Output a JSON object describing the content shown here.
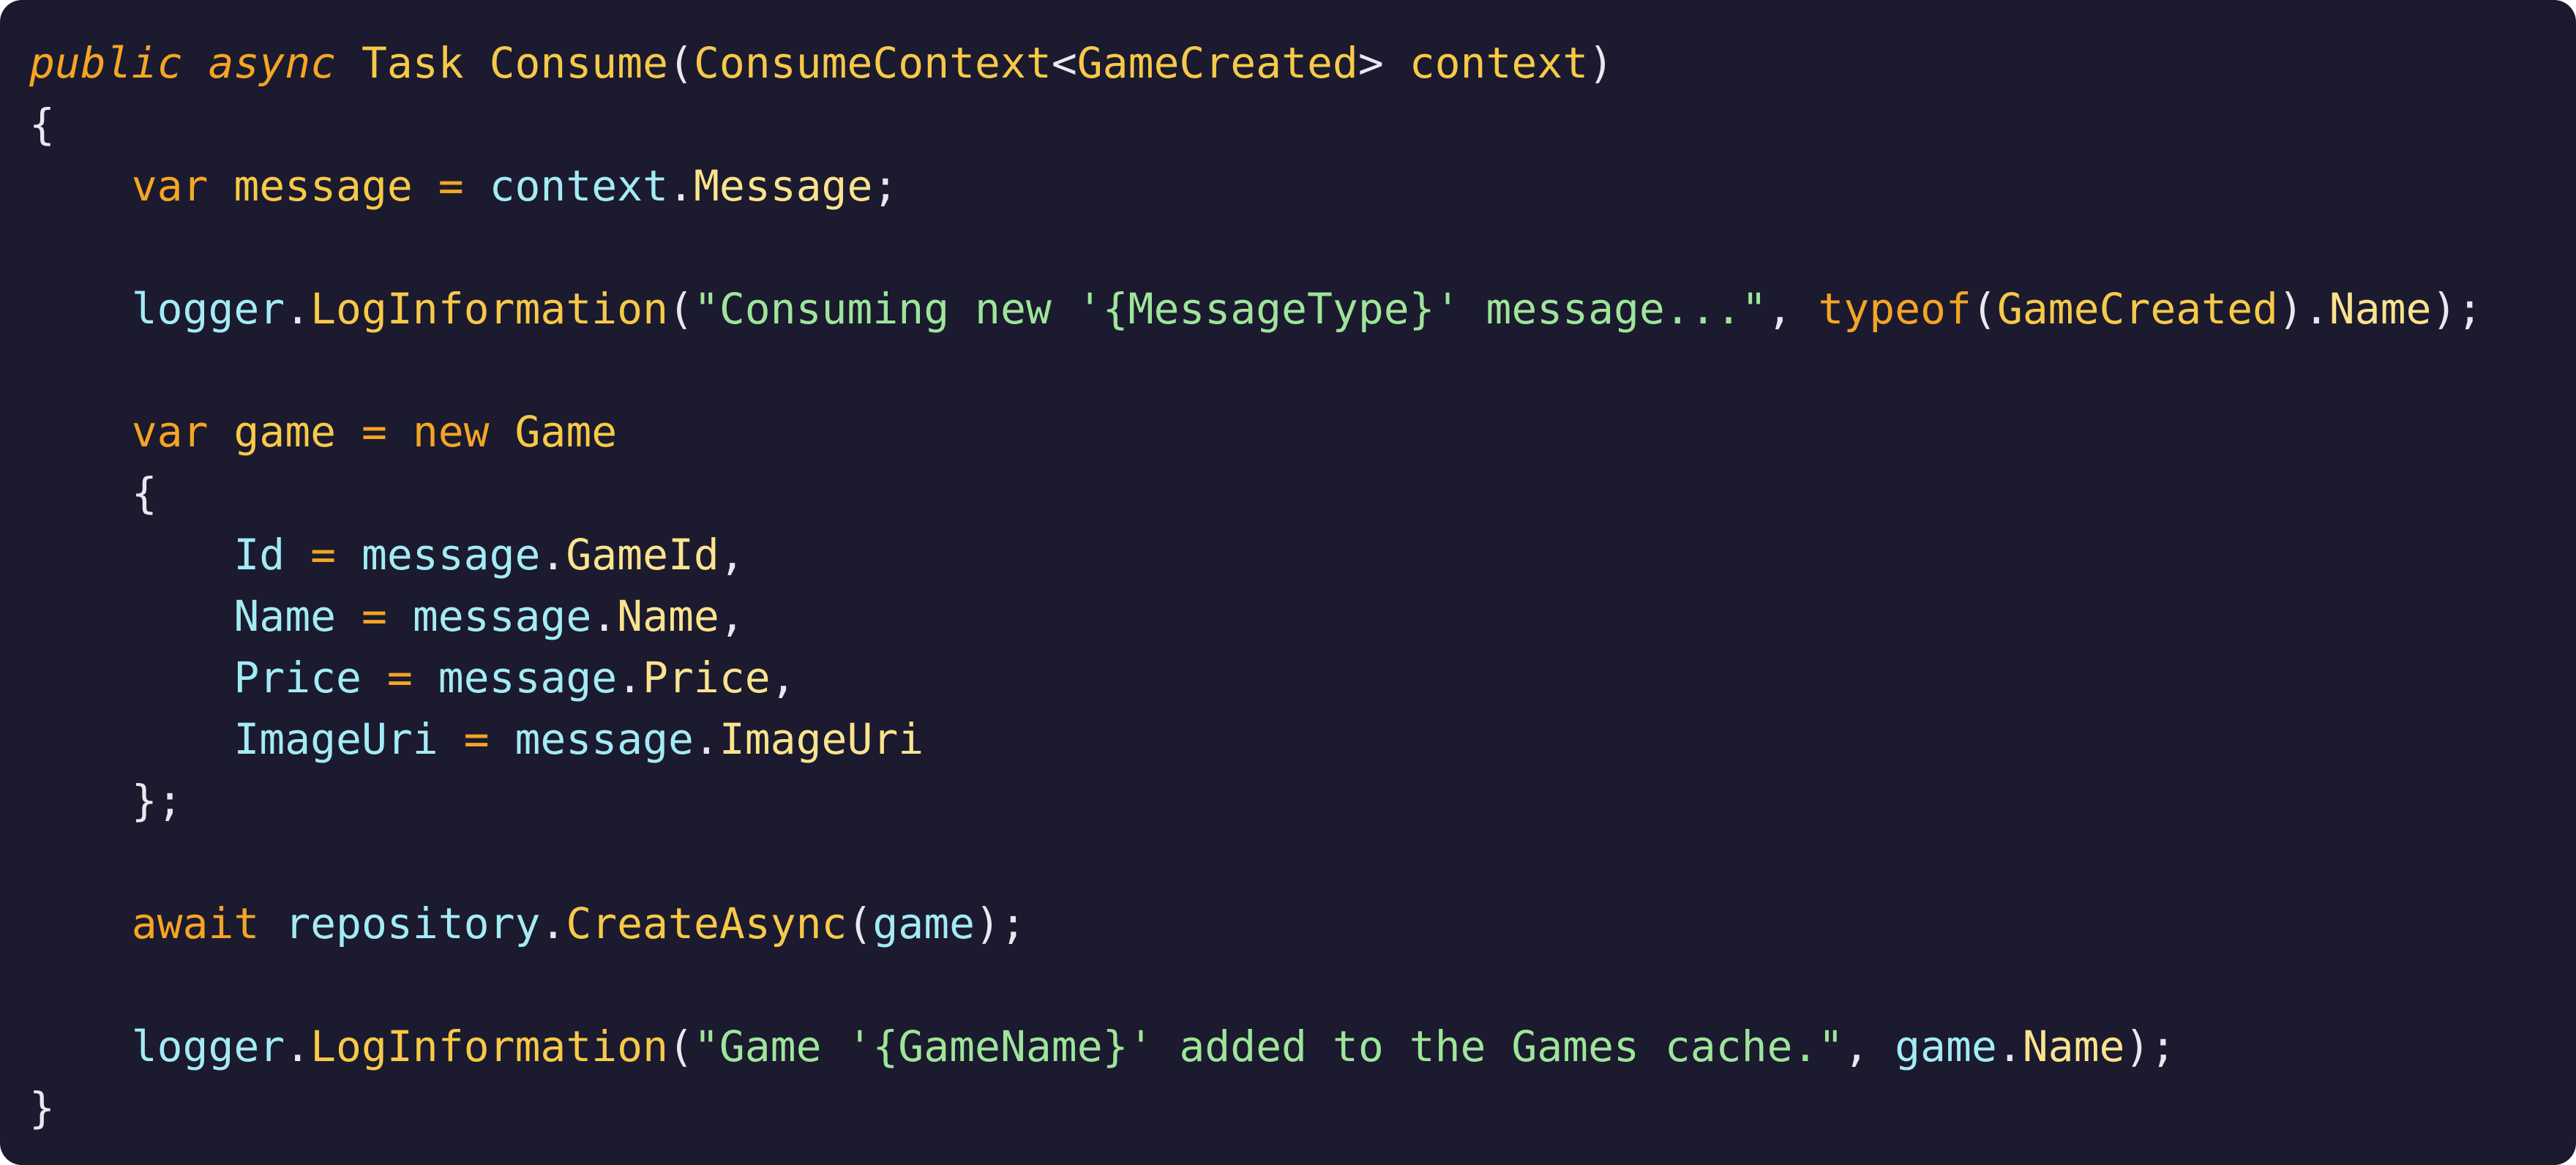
{
  "colors": {
    "background": "#1b1a2f",
    "keyword": "#f5a524",
    "type": "#f7c948",
    "method": "#f7c948",
    "member": "#fbe38e",
    "identifier": "#a3ebf5",
    "string": "#9ee59a",
    "punctuation": "#e8e8f0",
    "operator": "#f5a524"
  },
  "code": {
    "lines": [
      {
        "tokens": [
          {
            "t": "public",
            "c": "keyword",
            "i": true
          },
          {
            "t": " ",
            "c": "punctuation"
          },
          {
            "t": "async",
            "c": "keyword",
            "i": true
          },
          {
            "t": " ",
            "c": "punctuation"
          },
          {
            "t": "Task",
            "c": "type"
          },
          {
            "t": " ",
            "c": "punctuation"
          },
          {
            "t": "Consume",
            "c": "method"
          },
          {
            "t": "(",
            "c": "punctuation"
          },
          {
            "t": "ConsumeContext",
            "c": "type"
          },
          {
            "t": "<",
            "c": "punctuation"
          },
          {
            "t": "GameCreated",
            "c": "type"
          },
          {
            "t": "> ",
            "c": "punctuation"
          },
          {
            "t": "context",
            "c": "method"
          },
          {
            "t": ")",
            "c": "punctuation"
          }
        ]
      },
      {
        "tokens": [
          {
            "t": "{",
            "c": "punctuation"
          }
        ]
      },
      {
        "tokens": [
          {
            "t": "    ",
            "c": "punctuation"
          },
          {
            "t": "var",
            "c": "keyword"
          },
          {
            "t": " ",
            "c": "punctuation"
          },
          {
            "t": "message",
            "c": "type"
          },
          {
            "t": " ",
            "c": "punctuation"
          },
          {
            "t": "=",
            "c": "operator"
          },
          {
            "t": " ",
            "c": "punctuation"
          },
          {
            "t": "context",
            "c": "identifier"
          },
          {
            "t": ".",
            "c": "punctuation"
          },
          {
            "t": "Message",
            "c": "member"
          },
          {
            "t": ";",
            "c": "punctuation"
          }
        ]
      },
      {
        "tokens": []
      },
      {
        "tokens": [
          {
            "t": "    ",
            "c": "punctuation"
          },
          {
            "t": "logger",
            "c": "identifier"
          },
          {
            "t": ".",
            "c": "punctuation"
          },
          {
            "t": "LogInformation",
            "c": "method"
          },
          {
            "t": "(",
            "c": "punctuation"
          },
          {
            "t": "\"Consuming new '{MessageType}' message...\"",
            "c": "string"
          },
          {
            "t": ", ",
            "c": "punctuation"
          },
          {
            "t": "typeof",
            "c": "keyword"
          },
          {
            "t": "(",
            "c": "punctuation"
          },
          {
            "t": "GameCreated",
            "c": "type"
          },
          {
            "t": ").",
            "c": "punctuation"
          },
          {
            "t": "Name",
            "c": "member"
          },
          {
            "t": ");",
            "c": "punctuation"
          }
        ]
      },
      {
        "tokens": []
      },
      {
        "tokens": [
          {
            "t": "    ",
            "c": "punctuation"
          },
          {
            "t": "var",
            "c": "keyword"
          },
          {
            "t": " ",
            "c": "punctuation"
          },
          {
            "t": "game",
            "c": "type"
          },
          {
            "t": " ",
            "c": "punctuation"
          },
          {
            "t": "=",
            "c": "operator"
          },
          {
            "t": " ",
            "c": "punctuation"
          },
          {
            "t": "new",
            "c": "keyword"
          },
          {
            "t": " ",
            "c": "punctuation"
          },
          {
            "t": "Game",
            "c": "type"
          }
        ]
      },
      {
        "tokens": [
          {
            "t": "    ",
            "c": "punctuation"
          },
          {
            "t": "{",
            "c": "punctuation"
          }
        ]
      },
      {
        "tokens": [
          {
            "t": "        ",
            "c": "punctuation"
          },
          {
            "t": "Id",
            "c": "identifier"
          },
          {
            "t": " ",
            "c": "punctuation"
          },
          {
            "t": "=",
            "c": "operator"
          },
          {
            "t": " ",
            "c": "punctuation"
          },
          {
            "t": "message",
            "c": "identifier"
          },
          {
            "t": ".",
            "c": "punctuation"
          },
          {
            "t": "GameId",
            "c": "member"
          },
          {
            "t": ",",
            "c": "punctuation"
          }
        ]
      },
      {
        "tokens": [
          {
            "t": "        ",
            "c": "punctuation"
          },
          {
            "t": "Name",
            "c": "identifier"
          },
          {
            "t": " ",
            "c": "punctuation"
          },
          {
            "t": "=",
            "c": "operator"
          },
          {
            "t": " ",
            "c": "punctuation"
          },
          {
            "t": "message",
            "c": "identifier"
          },
          {
            "t": ".",
            "c": "punctuation"
          },
          {
            "t": "Name",
            "c": "member"
          },
          {
            "t": ",",
            "c": "punctuation"
          }
        ]
      },
      {
        "tokens": [
          {
            "t": "        ",
            "c": "punctuation"
          },
          {
            "t": "Price",
            "c": "identifier"
          },
          {
            "t": " ",
            "c": "punctuation"
          },
          {
            "t": "=",
            "c": "operator"
          },
          {
            "t": " ",
            "c": "punctuation"
          },
          {
            "t": "message",
            "c": "identifier"
          },
          {
            "t": ".",
            "c": "punctuation"
          },
          {
            "t": "Price",
            "c": "member"
          },
          {
            "t": ",",
            "c": "punctuation"
          }
        ]
      },
      {
        "tokens": [
          {
            "t": "        ",
            "c": "punctuation"
          },
          {
            "t": "ImageUri",
            "c": "identifier"
          },
          {
            "t": " ",
            "c": "punctuation"
          },
          {
            "t": "=",
            "c": "operator"
          },
          {
            "t": " ",
            "c": "punctuation"
          },
          {
            "t": "message",
            "c": "identifier"
          },
          {
            "t": ".",
            "c": "punctuation"
          },
          {
            "t": "ImageUri",
            "c": "member"
          }
        ]
      },
      {
        "tokens": [
          {
            "t": "    ",
            "c": "punctuation"
          },
          {
            "t": "};",
            "c": "punctuation"
          }
        ]
      },
      {
        "tokens": []
      },
      {
        "tokens": [
          {
            "t": "    ",
            "c": "punctuation"
          },
          {
            "t": "await",
            "c": "keyword"
          },
          {
            "t": " ",
            "c": "punctuation"
          },
          {
            "t": "repository",
            "c": "identifier"
          },
          {
            "t": ".",
            "c": "punctuation"
          },
          {
            "t": "CreateAsync",
            "c": "method"
          },
          {
            "t": "(",
            "c": "punctuation"
          },
          {
            "t": "game",
            "c": "identifier"
          },
          {
            "t": ");",
            "c": "punctuation"
          }
        ]
      },
      {
        "tokens": []
      },
      {
        "tokens": [
          {
            "t": "    ",
            "c": "punctuation"
          },
          {
            "t": "logger",
            "c": "identifier"
          },
          {
            "t": ".",
            "c": "punctuation"
          },
          {
            "t": "LogInformation",
            "c": "method"
          },
          {
            "t": "(",
            "c": "punctuation"
          },
          {
            "t": "\"Game '{GameName}' added to the Games cache.\"",
            "c": "string"
          },
          {
            "t": ", ",
            "c": "punctuation"
          },
          {
            "t": "game",
            "c": "identifier"
          },
          {
            "t": ".",
            "c": "punctuation"
          },
          {
            "t": "Name",
            "c": "member"
          },
          {
            "t": ");",
            "c": "punctuation"
          }
        ]
      },
      {
        "tokens": [
          {
            "t": "}",
            "c": "punctuation"
          }
        ]
      }
    ]
  }
}
